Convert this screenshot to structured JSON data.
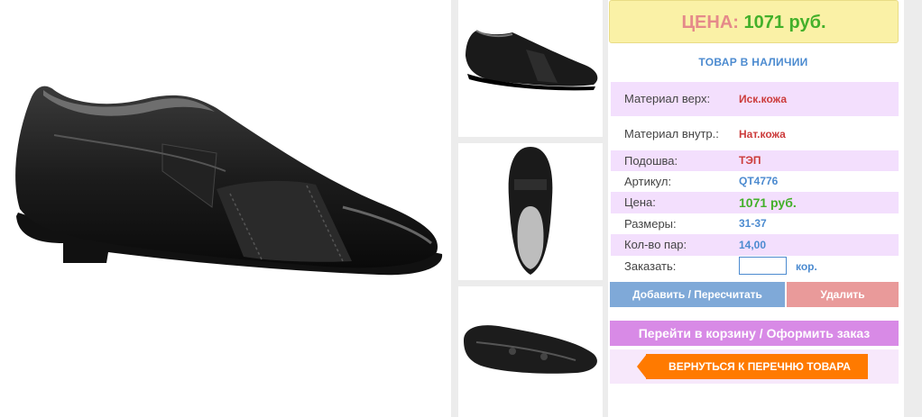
{
  "product": {
    "price_label": "ЦЕНА:",
    "price_value": "1071 руб.",
    "stock_status": "ТОВАР В НАЛИЧИИ"
  },
  "specs": [
    {
      "label": "Материал верх:",
      "value": "Иск.кожа"
    },
    {
      "label": "Материал внутр.:",
      "value": "Нат.кожа"
    },
    {
      "label": "Подошва:",
      "value": "ТЭП"
    },
    {
      "label": "Артикул:",
      "value": "QT4776"
    },
    {
      "label": "Цена:",
      "value": "1071 руб."
    },
    {
      "label": "Размеры:",
      "value": "31-37"
    },
    {
      "label": "Кол-во пар:",
      "value": "14,00"
    }
  ],
  "order": {
    "label": "Заказать:",
    "quantity": "",
    "unit": "кор."
  },
  "buttons": {
    "add": "Добавить / Пересчитать",
    "delete": "Удалить",
    "cart": "Перейти в корзину / Оформить заказ",
    "back": "ВЕРНУТЬСЯ К ПЕРЕЧНЮ ТОВАРА"
  },
  "colors": {
    "price_bg": "#faf1a6",
    "price_label": "#e58a8a",
    "price_value": "#43b02a",
    "accent_blue": "#4c8bd0",
    "accent_red": "#cc3b3b",
    "row_pink": "#f3dffd",
    "btn_add": "#7fa9d8",
    "btn_delete": "#e99a9a",
    "btn_cart": "#d88ae6",
    "btn_back": "#ff7a00"
  },
  "images": [
    "shoe-side-photo",
    "shoe-side-thumbnail",
    "shoe-top-thumbnail",
    "shoe-sole-thumbnail"
  ]
}
